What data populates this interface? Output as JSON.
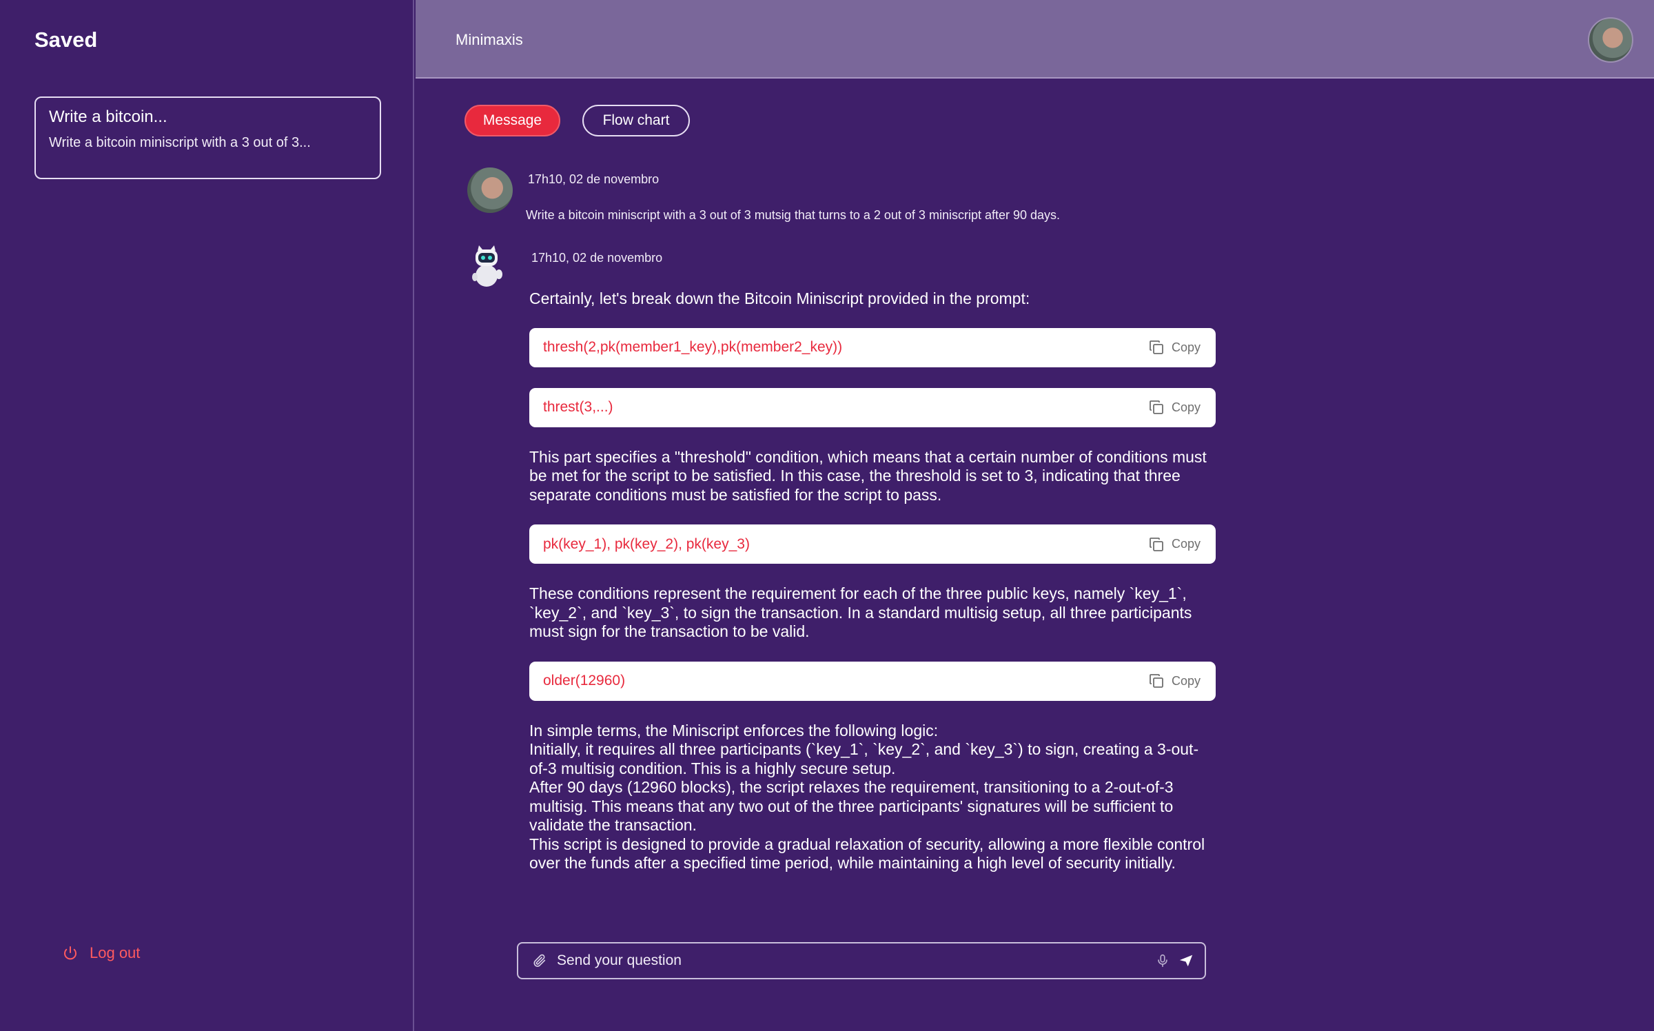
{
  "sidebar": {
    "title": "Saved",
    "saved_items": [
      {
        "title": "Write a bitcoin...",
        "preview": "Write a bitcoin miniscript with a 3 out of 3..."
      }
    ],
    "logout_label": "Log out"
  },
  "header": {
    "title": "Minimaxis"
  },
  "tabs": {
    "message": "Message",
    "flow_chart": "Flow chart"
  },
  "conversation": {
    "user_message": {
      "time": "17h10, 02 de novembro",
      "text": "Write a bitcoin miniscript with a 3 out of 3 mutsig that turns to a 2 out of 3 miniscript after 90 days."
    },
    "bot_message": {
      "time": "17h10, 02 de novembro",
      "intro": "Certainly, let's break down the Bitcoin Miniscript provided in the prompt:",
      "code_1": "thresh(2,pk(member1_key),pk(member2_key))",
      "code_2": "threst(3,...)",
      "para_1": "This part specifies a \"threshold\" condition, which means that a certain number of conditions must be met for the script to be satisfied. In this case, the threshold is set to 3, indicating that three separate conditions must be satisfied for the script to pass.",
      "code_3": "pk(key_1), pk(key_2), pk(key_3)",
      "para_2": "These conditions represent the requirement for each of the three public keys, namely `key_1`, `key_2`, and `key_3`, to sign the transaction. In a standard multisig setup, all three participants must sign for the transaction to be valid.",
      "code_4": "older(12960)",
      "summary_lines": [
        "In simple terms, the Miniscript enforces the following logic:",
        "Initially, it requires all three participants (`key_1`, `key_2`, and `key_3`) to sign, creating a 3-out-of-3 multisig condition. This is a highly secure setup.",
        "After 90 days (12960 blocks), the script relaxes the requirement, transitioning to a 2-out-of-3 multisig. This means that any two out of the three participants' signatures will be sufficient to validate the transaction.",
        "This script is designed to provide a gradual relaxation of security, allowing a more flexible control over the funds after a specified time period, while maintaining a high level of security initially."
      ],
      "copy_label": "Copy"
    }
  },
  "input": {
    "placeholder": "Send your question"
  },
  "colors": {
    "background": "#3f1f6a",
    "header": "#7a679a",
    "accent": "#e8293d"
  },
  "icons": [
    "power-icon",
    "copy-icon",
    "paperclip-icon",
    "microphone-icon",
    "send-icon"
  ]
}
